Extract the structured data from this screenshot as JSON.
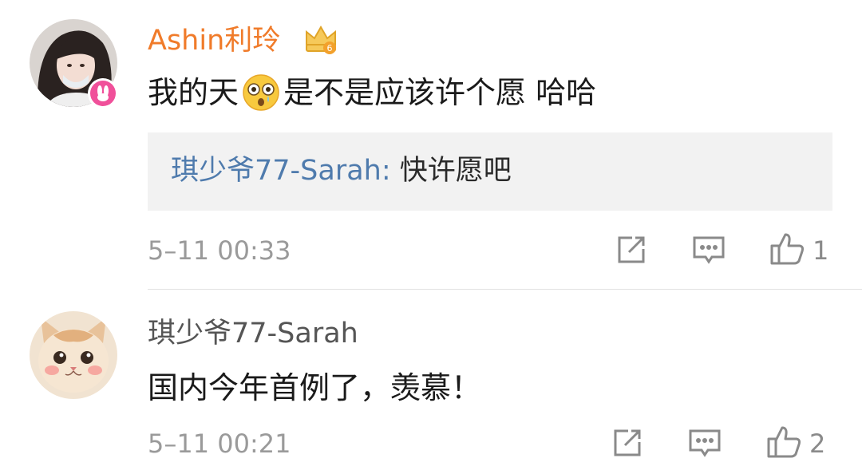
{
  "comments": [
    {
      "username": "Ashin利玲",
      "text_before": "我的天",
      "text_after": "是不是应该许个愿 哈哈",
      "emoji": "astonished-emoji",
      "reply": {
        "user": "琪少爷77-Sarah:",
        "message": " 快许愿吧"
      },
      "time": "5–11 00:33",
      "like_count": "1",
      "icons": {
        "share": "share-icon",
        "comment": "comment-icon",
        "like": "thumbs-up-icon",
        "crown": "crown-icon",
        "badge": "rabbit-badge-icon"
      }
    },
    {
      "username": "琪少爷77-Sarah",
      "text": "国内今年首例了，羡慕！",
      "time": "5–11 00:21",
      "like_count": "2",
      "icons": {
        "share": "share-icon",
        "comment": "comment-icon",
        "like": "thumbs-up-icon"
      }
    }
  ],
  "colors": {
    "vip_name": "#f07b2a",
    "reply_user": "#4f7bad",
    "meta": "#9a9a9a",
    "reply_bg": "#f2f2f2"
  }
}
